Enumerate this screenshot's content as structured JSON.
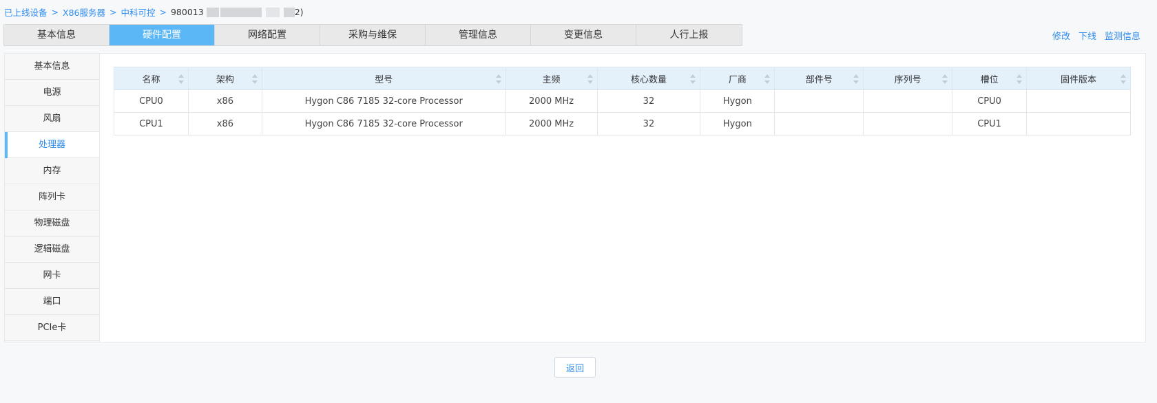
{
  "breadcrumb": {
    "items": [
      "已上线设备",
      "X86服务器",
      "中科可控"
    ],
    "separator": ">",
    "current_prefix": "980013",
    "current_suffix": "2)"
  },
  "tabs": [
    {
      "label": "基本信息",
      "active": false
    },
    {
      "label": "硬件配置",
      "active": true
    },
    {
      "label": "网络配置",
      "active": false
    },
    {
      "label": "采购与维保",
      "active": false
    },
    {
      "label": "管理信息",
      "active": false
    },
    {
      "label": "变更信息",
      "active": false
    },
    {
      "label": "人行上报",
      "active": false
    }
  ],
  "actions": {
    "edit": "修改",
    "offline": "下线",
    "monitor": "监测信息"
  },
  "sidebar": {
    "items": [
      "基本信息",
      "电源",
      "风扇",
      "处理器",
      "内存",
      "阵列卡",
      "物理磁盘",
      "逻辑磁盘",
      "网卡",
      "端口",
      "PCIe卡"
    ],
    "active_index": 3
  },
  "table": {
    "columns": [
      "名称",
      "架构",
      "型号",
      "主频",
      "核心数量",
      "厂商",
      "部件号",
      "序列号",
      "槽位",
      "固件版本"
    ],
    "rows": [
      [
        "CPU0",
        "x86",
        "Hygon C86 7185 32-core Processor",
        "2000 MHz",
        "32",
        "Hygon",
        "",
        "",
        "CPU0",
        ""
      ],
      [
        "CPU1",
        "x86",
        "Hygon C86 7185 32-core Processor",
        "2000 MHz",
        "32",
        "Hygon",
        "",
        "",
        "CPU1",
        ""
      ]
    ]
  },
  "footer": {
    "return_label": "返回"
  },
  "colors": {
    "accent": "#5cb7f7",
    "link": "#2d8cf0",
    "header_bg": "#e4f1fb"
  }
}
